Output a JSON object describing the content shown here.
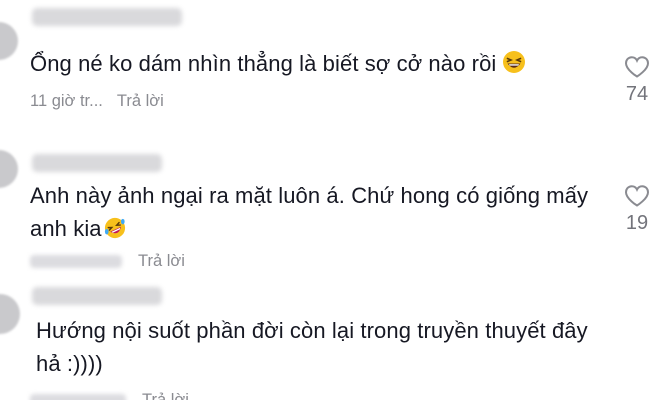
{
  "comments": [
    {
      "username": "",
      "text": "Ổng né ko dám nhìn thẳng là biết sợ cở nào rồi",
      "emoji": "grinning-squinting-face",
      "time": "11 giờ tr...",
      "reply_label": "Trả lời",
      "likes": "74"
    },
    {
      "username": "",
      "text": "Anh này ảnh ngại ra mặt luôn á. Chứ hong có giống mấy anh kia",
      "emoji": "rolling-on-floor-laughing-face",
      "time": "",
      "reply_label": "Trả lời",
      "likes": "19"
    },
    {
      "username": "",
      "text": "Hướng nội suốt phần đời còn lại trong truyền thuyết đây hả :))))",
      "emoji": "",
      "time": "",
      "reply_label": "Trả lời",
      "likes": ""
    }
  ],
  "colors": {
    "text": "#161823",
    "meta": "#8a8b91",
    "emoji_face": "#f7c01c"
  },
  "icons": {
    "like": "heart-outline-icon"
  }
}
